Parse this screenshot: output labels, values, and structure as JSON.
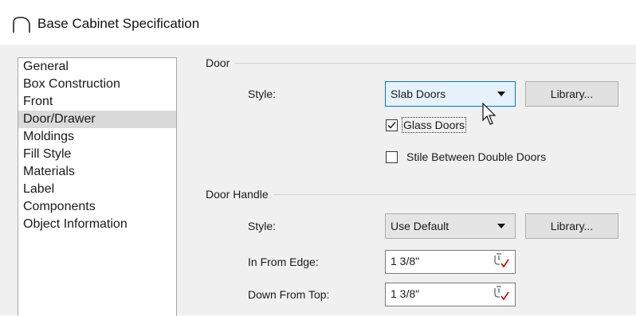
{
  "window": {
    "title": "Base Cabinet Specification",
    "icon": "cabinet-arc-icon"
  },
  "sidebar": {
    "items": [
      {
        "label": "General",
        "selected": false
      },
      {
        "label": "Box Construction",
        "selected": false
      },
      {
        "label": "Front",
        "selected": false
      },
      {
        "label": "Door/Drawer",
        "selected": true
      },
      {
        "label": "Moldings",
        "selected": false
      },
      {
        "label": "Fill Style",
        "selected": false
      },
      {
        "label": "Materials",
        "selected": false
      },
      {
        "label": "Label",
        "selected": false
      },
      {
        "label": "Components",
        "selected": false
      },
      {
        "label": "Object Information",
        "selected": false
      }
    ]
  },
  "door": {
    "group_label": "Door",
    "style_label": "Style:",
    "style_value": "Slab Doors",
    "library_label": "Library...",
    "glass_doors_label": "Glass Doors",
    "glass_doors_checked": true,
    "stile_label": "Stile Between Double Doors",
    "stile_checked": false
  },
  "door_handle": {
    "group_label": "Door Handle",
    "style_label": "Style:",
    "style_value": "Use Default",
    "library_label": "Library...",
    "in_from_edge_label": "In From Edge:",
    "in_from_edge_value": "1 3/8\"",
    "down_from_top_label": "Down From Top:",
    "down_from_top_value": "1 3/8\""
  },
  "colors": {
    "focus_border": "#0078d7",
    "selected_item": "#dadada",
    "dialog_bg": "#f0f0f0",
    "check_red": "#cc0000"
  }
}
